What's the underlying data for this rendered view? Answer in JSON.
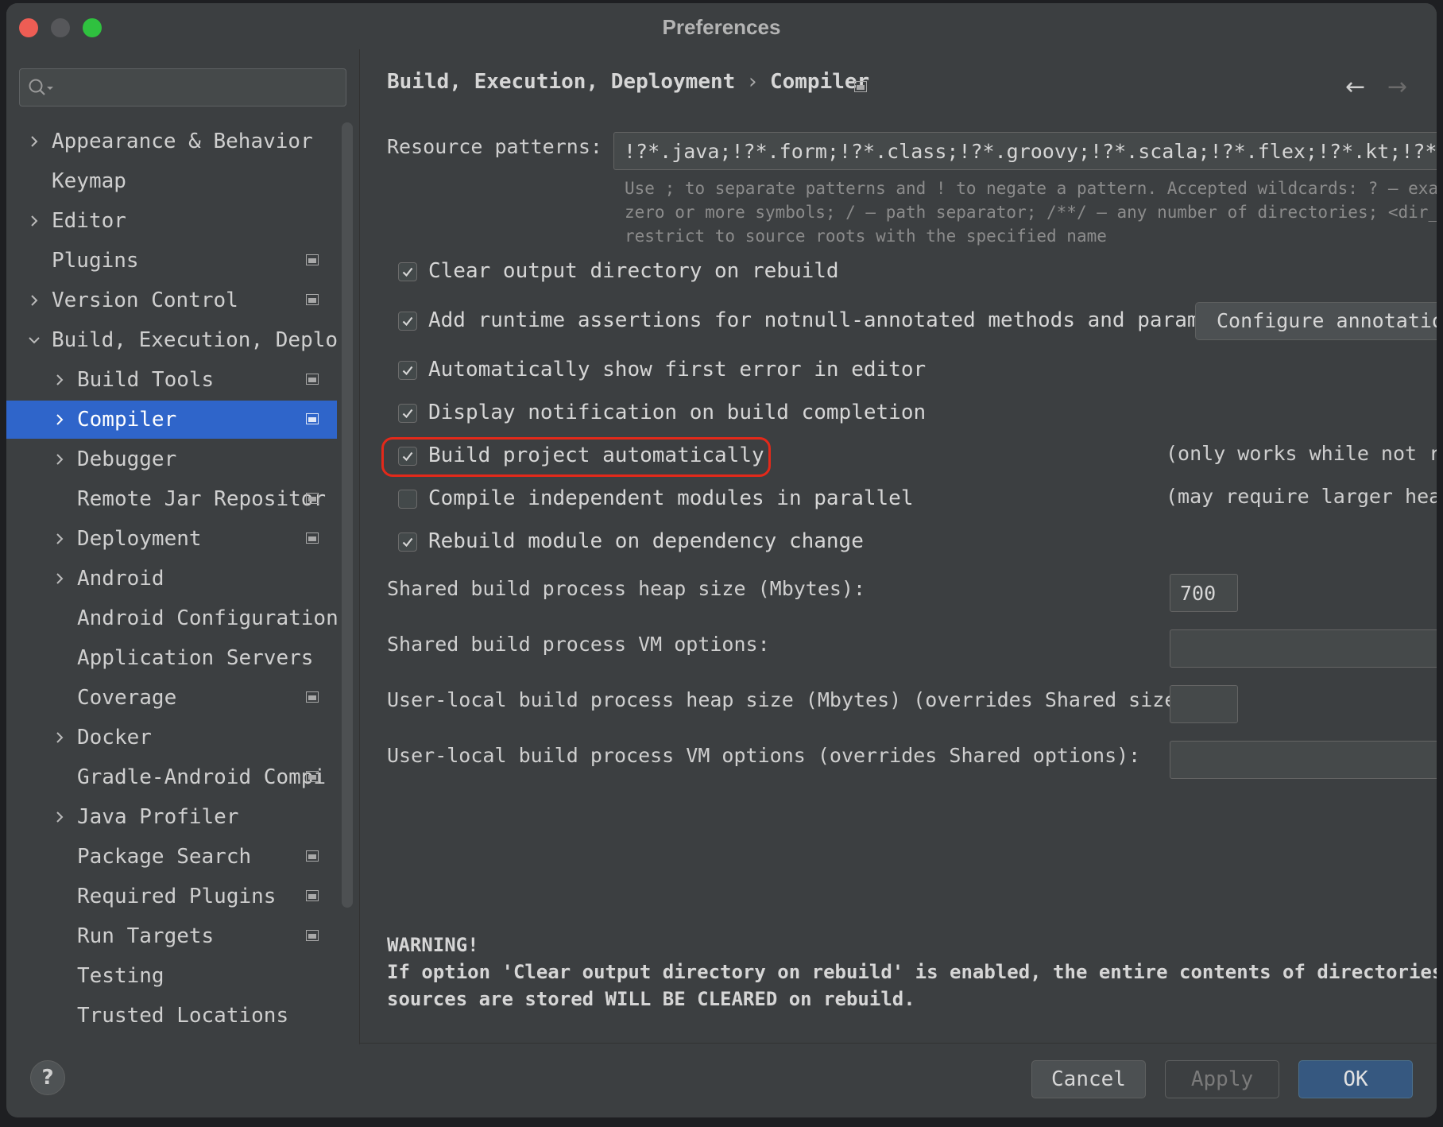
{
  "window": {
    "title": "Preferences"
  },
  "search": {
    "placeholder": "",
    "value": ""
  },
  "sidebar": {
    "items": [
      {
        "label": "Appearance & Behavior",
        "name": "sidebar-item-appearance-behavior",
        "expand": "collapsed",
        "project_icon": false,
        "selected": false,
        "level": 0
      },
      {
        "label": "Keymap",
        "name": "sidebar-item-keymap",
        "expand": "none",
        "project_icon": false,
        "selected": false,
        "level": 0
      },
      {
        "label": "Editor",
        "name": "sidebar-item-editor",
        "expand": "collapsed",
        "project_icon": false,
        "selected": false,
        "level": 0
      },
      {
        "label": "Plugins",
        "name": "sidebar-item-plugins",
        "expand": "none",
        "project_icon": true,
        "selected": false,
        "level": 0
      },
      {
        "label": "Version Control",
        "name": "sidebar-item-version-control",
        "expand": "collapsed",
        "project_icon": true,
        "selected": false,
        "level": 0
      },
      {
        "label": "Build, Execution, Deploy",
        "name": "sidebar-item-build-execution-deployment",
        "expand": "expanded",
        "project_icon": false,
        "selected": false,
        "level": 0
      },
      {
        "label": "Build Tools",
        "name": "sidebar-item-build-tools",
        "expand": "collapsed",
        "project_icon": true,
        "selected": false,
        "level": 1
      },
      {
        "label": "Compiler",
        "name": "sidebar-item-compiler",
        "expand": "collapsed",
        "project_icon": true,
        "selected": true,
        "level": 1
      },
      {
        "label": "Debugger",
        "name": "sidebar-item-debugger",
        "expand": "collapsed",
        "project_icon": false,
        "selected": false,
        "level": 1
      },
      {
        "label": "Remote Jar Repositor",
        "name": "sidebar-item-remote-jar-repositories",
        "expand": "none",
        "project_icon": true,
        "selected": false,
        "level": 1
      },
      {
        "label": "Deployment",
        "name": "sidebar-item-deployment",
        "expand": "collapsed",
        "project_icon": true,
        "selected": false,
        "level": 1
      },
      {
        "label": "Android",
        "name": "sidebar-item-android",
        "expand": "collapsed",
        "project_icon": false,
        "selected": false,
        "level": 1
      },
      {
        "label": "Android Configurations",
        "name": "sidebar-item-android-configurations",
        "expand": "none",
        "project_icon": false,
        "selected": false,
        "level": 1
      },
      {
        "label": "Application Servers",
        "name": "sidebar-item-application-servers",
        "expand": "none",
        "project_icon": false,
        "selected": false,
        "level": 1
      },
      {
        "label": "Coverage",
        "name": "sidebar-item-coverage",
        "expand": "none",
        "project_icon": true,
        "selected": false,
        "level": 1
      },
      {
        "label": "Docker",
        "name": "sidebar-item-docker",
        "expand": "collapsed",
        "project_icon": false,
        "selected": false,
        "level": 1
      },
      {
        "label": "Gradle-Android Compi",
        "name": "sidebar-item-gradle-android-compiler",
        "expand": "none",
        "project_icon": true,
        "selected": false,
        "level": 1
      },
      {
        "label": "Java Profiler",
        "name": "sidebar-item-java-profiler",
        "expand": "collapsed",
        "project_icon": false,
        "selected": false,
        "level": 1
      },
      {
        "label": "Package Search",
        "name": "sidebar-item-package-search",
        "expand": "none",
        "project_icon": true,
        "selected": false,
        "level": 1
      },
      {
        "label": "Required Plugins",
        "name": "sidebar-item-required-plugins",
        "expand": "none",
        "project_icon": true,
        "selected": false,
        "level": 1
      },
      {
        "label": "Run Targets",
        "name": "sidebar-item-run-targets",
        "expand": "none",
        "project_icon": true,
        "selected": false,
        "level": 1
      },
      {
        "label": "Testing",
        "name": "sidebar-item-testing",
        "expand": "none",
        "project_icon": false,
        "selected": false,
        "level": 1
      },
      {
        "label": "Trusted Locations",
        "name": "sidebar-item-trusted-locations",
        "expand": "none",
        "project_icon": false,
        "selected": false,
        "level": 1
      }
    ]
  },
  "breadcrumb": {
    "parent": "Build, Execution, Deployment",
    "separator": "›",
    "current": "Compiler"
  },
  "nav": {
    "back": "←",
    "forward": "→"
  },
  "resource": {
    "label": "Resource patterns:",
    "value": "!?*.java;!?*.form;!?*.class;!?*.groovy;!?*.scala;!?*.flex;!?*.kt;!?*.clj;!",
    "hint_line1": "Use ; to separate patterns and ! to negate a pattern. Accepted wildcards: ? — exactly",
    "hint_line2": "zero or more symbols; / — path separator; /**/ — any number of directories; <dir_name>",
    "hint_line3": "restrict to source roots with the specified name"
  },
  "options": {
    "clear_output": {
      "label": "Clear output directory on rebuild",
      "checked": true
    },
    "runtime_assertions": {
      "label": "Add runtime assertions for notnull-annotated methods and parameters",
      "checked": true
    },
    "configure_annotations": "Configure annotations",
    "show_first_error": {
      "label": "Automatically show first error in editor",
      "checked": true
    },
    "display_notification": {
      "label": "Display notification on build completion",
      "checked": true
    },
    "build_automatically": {
      "label": "Build project automatically",
      "checked": true,
      "note": "(only works while not run"
    },
    "compile_parallel": {
      "label": "Compile independent modules in parallel",
      "checked": false,
      "note": "(may require larger heap"
    },
    "rebuild_on_dependency": {
      "label": "Rebuild module on dependency change",
      "checked": true
    }
  },
  "fields": {
    "shared_heap": {
      "label": "Shared build process heap size (Mbytes):",
      "value": "700"
    },
    "shared_vm": {
      "label": "Shared build process VM options:",
      "value": ""
    },
    "user_heap": {
      "label": "User-local build process heap size (Mbytes) (overrides Shared size):",
      "value": ""
    },
    "user_vm": {
      "label": "User-local build process VM options (overrides Shared options):",
      "value": ""
    }
  },
  "warning": {
    "title": "WARNING!",
    "line1": "If option 'Clear output directory on rebuild' is enabled, the entire contents of directories wh",
    "line2": "sources are stored WILL BE CLEARED on rebuild."
  },
  "footer": {
    "help": "?",
    "cancel": "Cancel",
    "apply": "Apply",
    "ok": "OK"
  },
  "colors": {
    "selection": "#2f65ca",
    "highlight_ring": "#e3291a",
    "ok_button": "#365880",
    "background": "#3c3f41"
  }
}
